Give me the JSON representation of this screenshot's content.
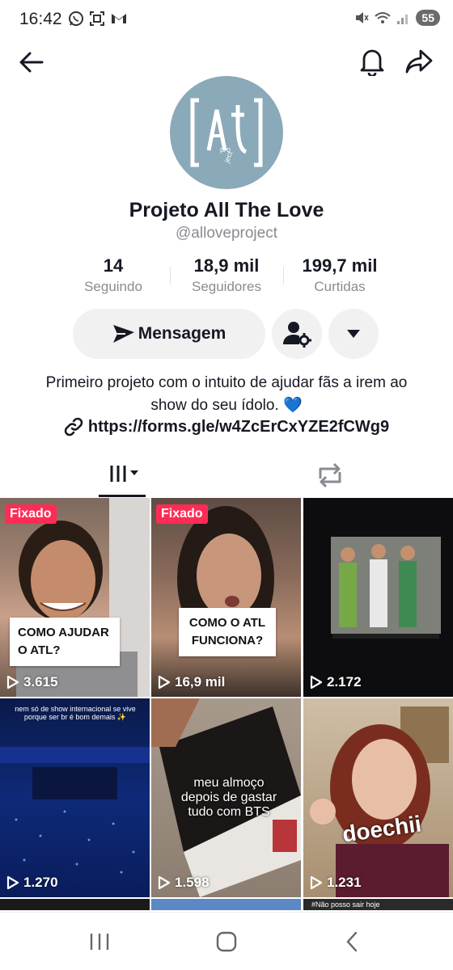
{
  "status_bar": {
    "time": "16:42",
    "battery": "55",
    "icons": [
      "whatsapp-icon",
      "screenshot-icon",
      "gmail-icon",
      "mute-icon",
      "wifi-icon",
      "signal-icon"
    ]
  },
  "header": {
    "back_icon": "arrow-left-icon",
    "bell_icon": "bell-icon",
    "share_icon": "share-arrow-icon"
  },
  "profile": {
    "display_name": "Projeto All The Love",
    "username": "@alloveproject",
    "avatar_logo_text": "[a†l] project",
    "stats": [
      {
        "value": "14",
        "label": "Seguindo"
      },
      {
        "value": "18,9 mil",
        "label": "Seguidores"
      },
      {
        "value": "199,7 mil",
        "label": "Curtidas"
      }
    ],
    "bio": "Primeiro projeto com o intuito de ajudar fãs a irem ao show do seu ídolo. 💙",
    "link": "https://forms.gle/w4ZcErCxYZE2fCWg9"
  },
  "actions": {
    "message_label": "Mensagem",
    "suggest_icon": "add-friend-settings-icon",
    "dropdown_icon": "caret-down-icon"
  },
  "tabs": [
    {
      "name": "videos",
      "icon": "grid-bars-icon",
      "active": true
    },
    {
      "name": "reposts",
      "icon": "repost-icon",
      "active": false
    }
  ],
  "videos": [
    {
      "pinned_label": "Fixado",
      "caption": "COMO AJUDAR O ATL?",
      "views": "3.615"
    },
    {
      "pinned_label": "Fixado",
      "caption": "COMO O ATL FUNCIONA?",
      "views": "16,9 mil"
    },
    {
      "pinned_label": "",
      "caption": "",
      "views": "2.172"
    },
    {
      "pinned_label": "",
      "caption": "nem só de show internacional se vive porque ser br é bom demais ✨",
      "views": "1.270"
    },
    {
      "pinned_label": "",
      "caption": "meu almoço depois de gastar tudo com BTS",
      "views": "1.598"
    },
    {
      "pinned_label": "",
      "caption": "doechii",
      "views": "1.231"
    }
  ],
  "partial_row": {
    "last_caption": "#Não posso sair hoje"
  },
  "bottom_nav": {
    "icons": [
      "recents-icon",
      "home-icon",
      "back-icon"
    ]
  },
  "colors": {
    "accent_pink": "#fe2c55",
    "avatar_bg": "#8aa9b9",
    "button_bg": "#f1f1f2",
    "muted_text": "#8a8b91"
  }
}
